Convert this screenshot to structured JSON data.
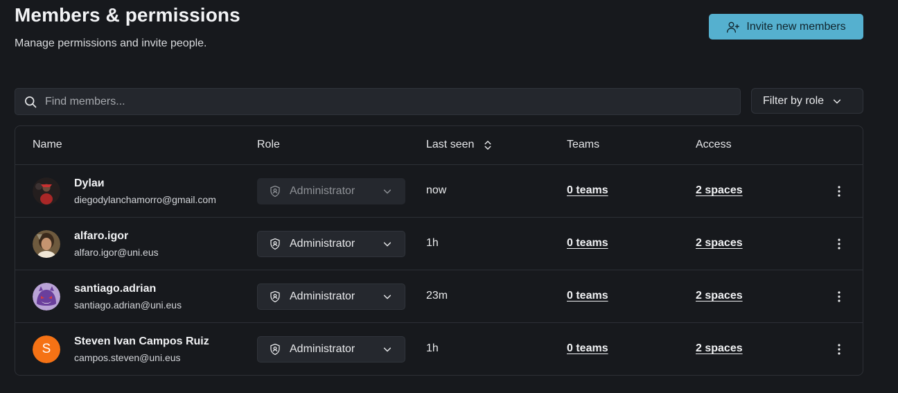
{
  "header": {
    "title": "Members & permissions",
    "subtitle": "Manage permissions and invite people.",
    "invite_label": "Invite new members"
  },
  "toolbar": {
    "search_placeholder": "Find members...",
    "filter_label": "Filter by role"
  },
  "table": {
    "columns": {
      "name": "Name",
      "role": "Role",
      "last_seen": "Last seen",
      "teams": "Teams",
      "access": "Access"
    },
    "rows": [
      {
        "name": "Dylaи",
        "email": "diegodylanchamorro@gmail.com",
        "role": "Administrator",
        "last_seen": "now",
        "teams": "0 teams",
        "access": "2 spaces",
        "avatar_letter": ""
      },
      {
        "name": "alfaro.igor",
        "email": "alfaro.igor@uni.eus",
        "role": "Administrator",
        "last_seen": "1h",
        "teams": "0 teams",
        "access": "2 spaces",
        "avatar_letter": ""
      },
      {
        "name": "santiago.adrian",
        "email": "santiago.adrian@uni.eus",
        "role": "Administrator",
        "last_seen": "23m",
        "teams": "0 teams",
        "access": "2 spaces",
        "avatar_letter": ""
      },
      {
        "name": "Steven Ivan Campos Ruiz",
        "email": "campos.steven@uni.eus",
        "role": "Administrator",
        "last_seen": "1h",
        "teams": "0 teams",
        "access": "2 spaces",
        "avatar_letter": "S"
      }
    ]
  },
  "icons": {
    "invite": "user-plus-icon",
    "search": "search-icon",
    "filter_chevron": "chevron-down-icon",
    "sort": "sort-icon",
    "role": "shield-icon",
    "row_menu": "more-vertical-icon"
  },
  "colors": {
    "background": "#17191d",
    "accent": "#55b0cf",
    "avatar_fallback": "#f57215"
  }
}
